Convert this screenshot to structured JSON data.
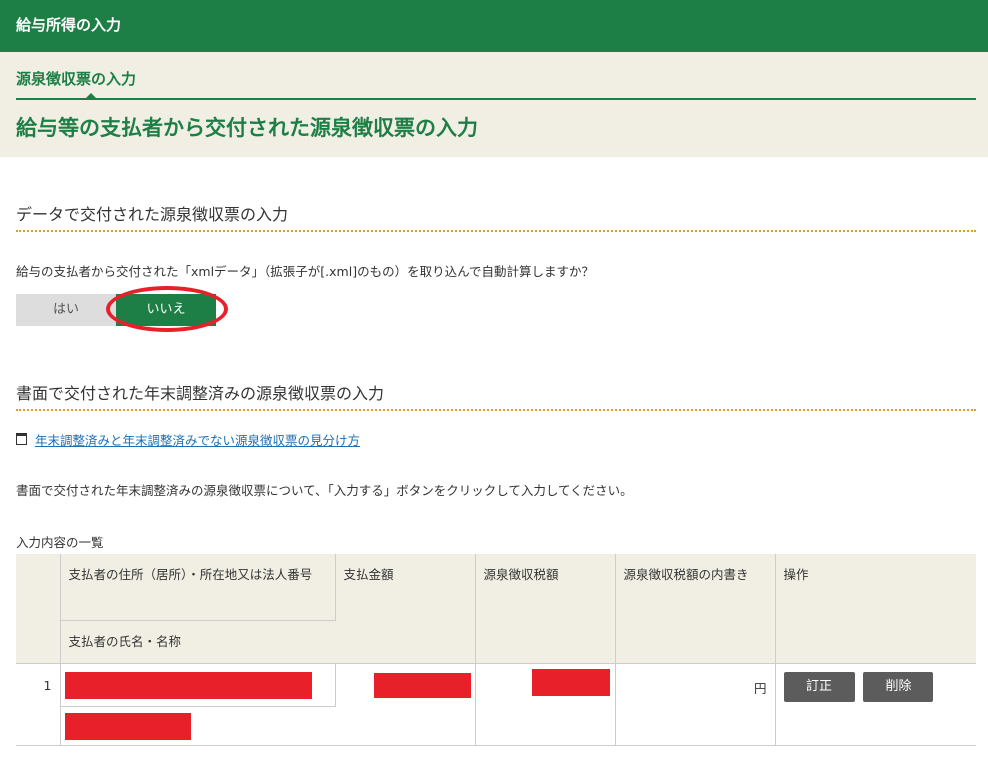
{
  "app": {
    "title": "給与所得の入力"
  },
  "header": {
    "step": "源泉徴収票の入力",
    "page_title": "給与等の支払者から交付された源泉徴収票の入力"
  },
  "data_section": {
    "title": "データで交付された源泉徴収票の入力",
    "question": "給与の支払者から交付された「xmlデータ」（拡張子が[.xml]のもの）を取り込んで自動計算しますか？",
    "yes_label": "はい",
    "no_label": "いいえ",
    "selected": "いいえ"
  },
  "paper_section": {
    "title": "書面で交付された年末調整済みの源泉徴収票の入力",
    "link_text": "年末調整済みと年末調整済みでない源泉徴収票の見分け方",
    "instruction": "書面で交付された年末調整済みの源泉徴収票について、「入力する」ボタンをクリックして入力してください。"
  },
  "table": {
    "caption": "入力内容の一覧",
    "headers": {
      "address": "支払者の住所（居所）・所在地又は法人番号",
      "name": "支払者の氏名・名称",
      "amount": "支払金額",
      "tax": "源泉徴収税額",
      "breakdown": "源泉徴収税額の内書き",
      "operation": "操作"
    },
    "rows": [
      {
        "no": "1",
        "breakdown_unit": "円",
        "edit_label": "訂正",
        "delete_label": "削除"
      }
    ]
  },
  "colors": {
    "primary_green": "#1e7f46",
    "header_bg": "#f1efe4",
    "accent_dots": "#d9a224",
    "annotation_red": "#e8202a",
    "button_gray": "#5c5c5c"
  }
}
